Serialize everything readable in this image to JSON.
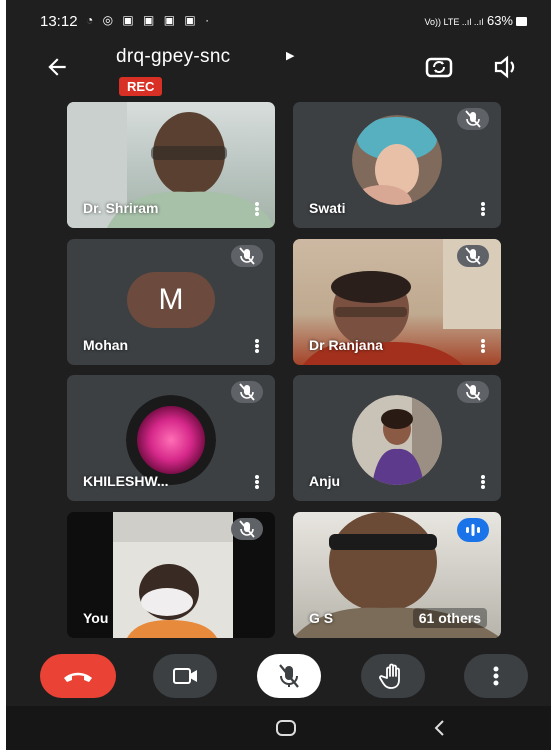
{
  "status_bar": {
    "time": "13:12",
    "left_icons": "◔ ◎ ▣ ▣ ▣ ▣ ·",
    "network": "Vo)) LTE ..ıl ..ıl",
    "battery": "63%"
  },
  "header": {
    "meeting_code": "drq-gpey-snc",
    "recording_badge": "REC"
  },
  "participants": [
    {
      "name": "Dr. Shriram",
      "muted": false,
      "display": "video"
    },
    {
      "name": "Swati",
      "muted": true,
      "display": "avatar-photo"
    },
    {
      "name": "Mohan",
      "muted": true,
      "display": "initial",
      "initial": "M",
      "avatar_color": "#6d4a3e"
    },
    {
      "name": "Dr Ranjana",
      "muted": true,
      "display": "video"
    },
    {
      "name": "KHILESHW...",
      "muted": true,
      "display": "avatar-photo"
    },
    {
      "name": "Anju",
      "muted": true,
      "display": "avatar-photo"
    },
    {
      "name": "You",
      "muted": true,
      "display": "video"
    },
    {
      "name": "G S",
      "muted": false,
      "speaking": true,
      "display": "video"
    }
  ],
  "others_count": "61 others",
  "controls": [
    "end-call",
    "camera",
    "microphone",
    "raise-hand",
    "more-options"
  ],
  "colors": {
    "background": "#1f1f20",
    "tile": "#3c4043",
    "rec": "#d93025",
    "end_call": "#ea4335",
    "speaking": "#1a73e8"
  }
}
